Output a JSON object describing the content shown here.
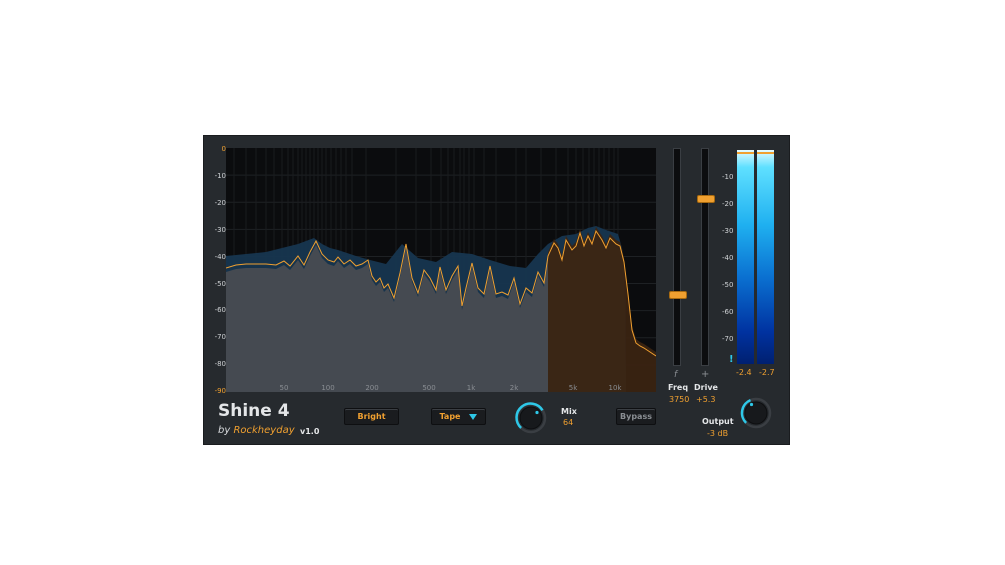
{
  "plugin": {
    "title": "Shine 4",
    "byline_prefix": "by",
    "brand": "Rockheyday",
    "version": "v1.0"
  },
  "db_scale": [
    "0",
    "-10",
    "-20",
    "-30",
    "-40",
    "-50",
    "-60",
    "-70",
    "-80",
    "-90"
  ],
  "freq_labels": [
    "50",
    "100",
    "200",
    "500",
    "1k",
    "2k",
    "5k",
    "10k"
  ],
  "buttons": {
    "bright": "Bright",
    "mode": "Tape",
    "bypass": "Bypass"
  },
  "mix": {
    "label": "Mix",
    "value": "64"
  },
  "freq": {
    "label": "Freq",
    "value": "3750",
    "icon_glyph": "f",
    "level": 0.33
  },
  "drive": {
    "label": "Drive",
    "value": "+5.3",
    "icon_glyph": "+",
    "level": 0.77
  },
  "output": {
    "label": "Output",
    "value": "-3 dB"
  },
  "meters": {
    "left_value": "-2.4",
    "right_value": "-2.7",
    "scale": [
      "-10",
      "-20",
      "-30",
      "-40",
      "-50",
      "-60",
      "-70"
    ],
    "clip_glyph": "!"
  },
  "colors": {
    "accent_orange": "#f0a030",
    "accent_cyan": "#2ec8e8",
    "panel": "#262a2e",
    "spectrum_bg": "#0b0c0e"
  }
}
